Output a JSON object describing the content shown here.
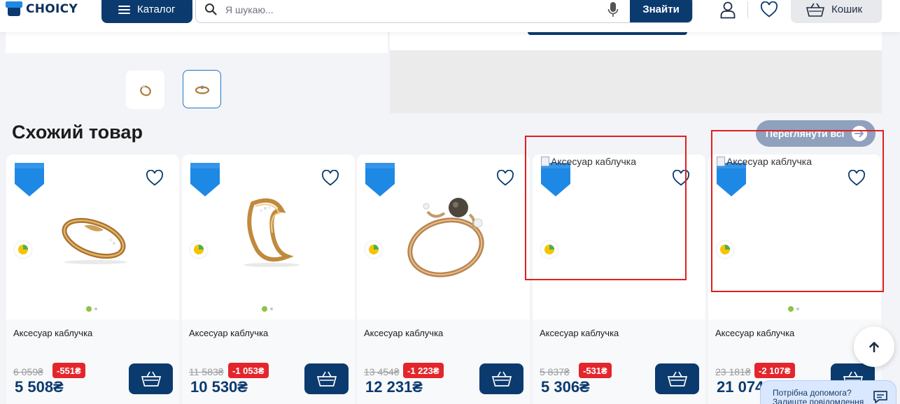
{
  "header": {
    "logo_text": "CHOICY",
    "catalog_label": "Каталог",
    "search_placeholder": "Я шукаю...",
    "find_label": "Знайти",
    "cart_label": "Кошик"
  },
  "section": {
    "title": "Схожий товар",
    "view_all_label": "Переглянути всі"
  },
  "products": [
    {
      "name": "Аксесуар каблучка",
      "old_price": "6 059₴",
      "discount": "-551₴",
      "price": "5 508₴",
      "image": "ring-gold-twist",
      "dots": true
    },
    {
      "name": "Аксесуар каблучка",
      "old_price": "11 583₴",
      "discount": "-1 053₴",
      "price": "10 530₴",
      "image": "ring-gold-wave",
      "dots": true
    },
    {
      "name": "Аксесуар каблучка",
      "old_price": "13 454₴",
      "discount": "-1 223₴",
      "price": "12 231₴",
      "image": "ring-smoky-stone",
      "dots": false
    },
    {
      "name": "Аксесуар каблучка",
      "old_price": "5 837₴",
      "discount": "-531₴",
      "price": "5 306₴",
      "image_alt": "Аксесуар каблучка",
      "dots": false
    },
    {
      "name": "Аксесуар каблучка",
      "old_price": "23 181₴",
      "discount": "-2 107₴",
      "price": "21 074₴",
      "image_alt": "Аксесуар каблучка",
      "dots": true
    }
  ],
  "help": {
    "line1": "Потрібна допомога?",
    "line2": "Залиште повідомлення"
  },
  "colors": {
    "brand_navy": "#0b3a6e",
    "accent_blue": "#1e88e5",
    "discount_red": "#e3262c",
    "highlight_red": "#e01f1f"
  }
}
